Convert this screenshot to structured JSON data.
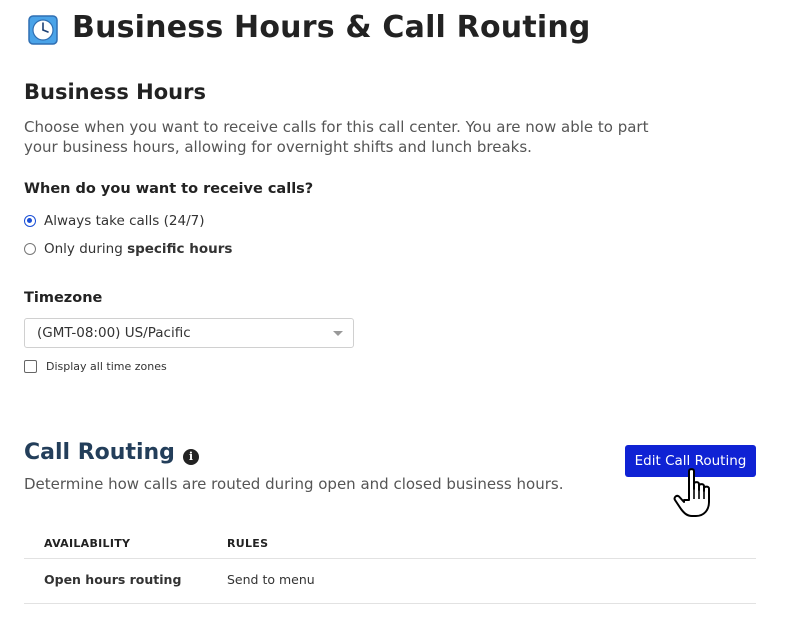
{
  "header": {
    "title": "Business Hours & Call Routing",
    "icon": "clock-icon"
  },
  "business_hours": {
    "title": "Business Hours",
    "description": "Choose when you want to receive calls for this call center. You are now able to part your business hours, allowing for overnight shifts and lunch breaks.",
    "question": "When do you want to receive calls?",
    "options": [
      {
        "label": "Always take calls (24/7)",
        "selected": true
      },
      {
        "label_prefix": "Only during ",
        "label_bold": "specific hours",
        "selected": false
      }
    ]
  },
  "timezone": {
    "label": "Timezone",
    "value": "(GMT-08:00) US/Pacific",
    "show_all_label": "Display all time zones",
    "show_all_checked": false
  },
  "call_routing": {
    "title": "Call Routing",
    "info_icon": "info-icon",
    "description": "Determine how calls are routed during open and closed business hours.",
    "edit_button": "Edit Call Routing",
    "table": {
      "columns": [
        "AVAILABILITY",
        "RULES"
      ],
      "rows": [
        {
          "availability": "Open hours routing",
          "rule": "Send to menu"
        }
      ]
    }
  },
  "colors": {
    "accent": "#0f22d4",
    "radio_selected": "#1a4fd6",
    "call_routing_title": "#233e5a"
  }
}
